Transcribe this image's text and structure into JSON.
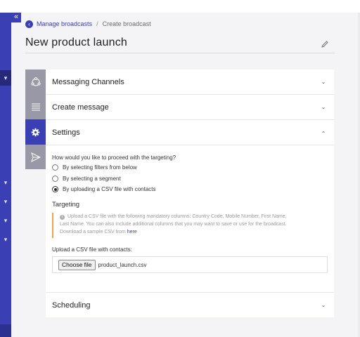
{
  "colors": {
    "accent": "#3a3fb3",
    "sidebar": "#3a3fb3",
    "warning": "#f0a44a"
  },
  "breadcrumb": {
    "parent": "Manage broadcasts",
    "separator": "/",
    "current": "Create broadcast"
  },
  "page": {
    "title": "New product launch"
  },
  "steps": [
    {
      "icon": "channels-icon"
    },
    {
      "icon": "message-lines-icon"
    },
    {
      "icon": "gear-icon",
      "active": true
    },
    {
      "icon": "send-icon"
    }
  ],
  "sections": {
    "messaging": {
      "label": "Messaging Channels",
      "state": "collapsed"
    },
    "create": {
      "label": "Create message",
      "state": "collapsed"
    },
    "settings": {
      "label": "Settings",
      "state": "expanded"
    },
    "scheduling": {
      "label": "Scheduling",
      "state": "collapsed"
    }
  },
  "targeting": {
    "question": "How would you like to proceed with the targeting?",
    "options": [
      {
        "label": "By selecting filters from below",
        "selected": false
      },
      {
        "label": "By selecting a segment",
        "selected": false
      },
      {
        "label": "By uploading a CSV file with contacts",
        "selected": true
      }
    ],
    "title": "Targeting",
    "info_line1": "Upload a CSV file with the following mandatory columns: Country Code, Mobile Number, First Name,",
    "info_line2": "Last Name. You can also include additional columns that you may want to save or use for the broadcast.",
    "info_line3": "Download a sample CSV from",
    "info_link": "here"
  },
  "upload": {
    "label": "Upload a CSV file with contacts:",
    "button": "Choose file",
    "file_name": "product_launch.csv"
  },
  "sidebar": {
    "collapse_glyph": "«"
  }
}
